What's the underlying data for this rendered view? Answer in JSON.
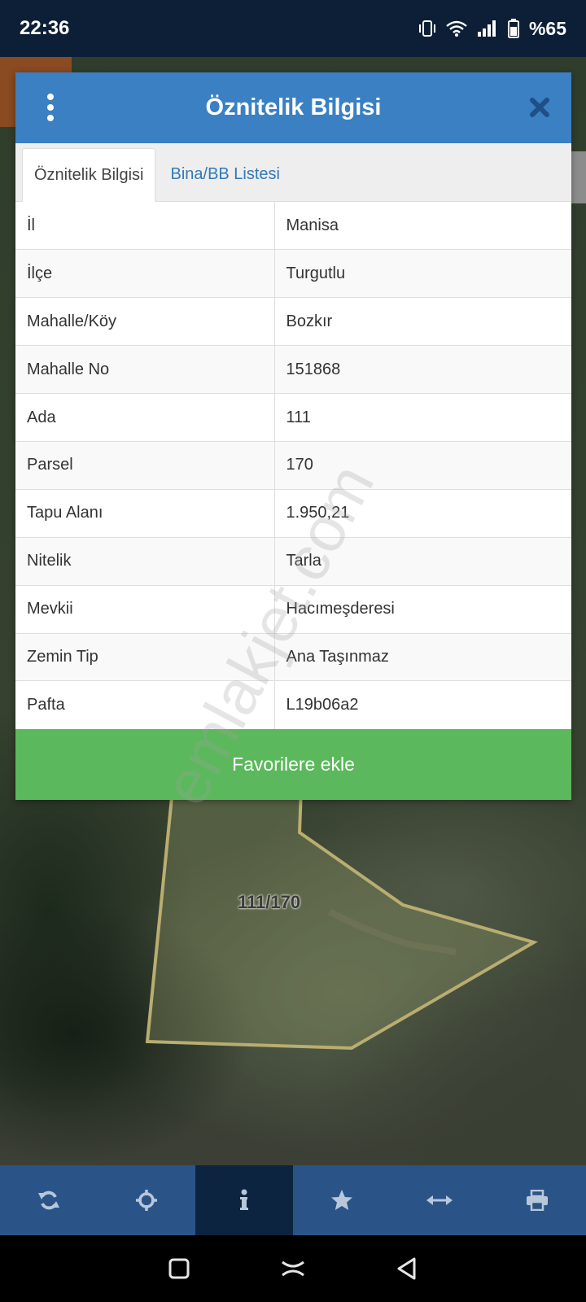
{
  "status_bar": {
    "time": "22:36",
    "battery": "%65",
    "icons": [
      "vibrate-icon",
      "wifi-icon",
      "signal-icon",
      "battery-icon"
    ]
  },
  "dialog": {
    "title": "Öznitelik Bilgisi",
    "menu_icon": "more-vertical-icon",
    "close_icon": "close-icon",
    "tabs": [
      {
        "label": "Öznitelik Bilgisi",
        "active": true
      },
      {
        "label": "Bina/BB Listesi",
        "active": false
      }
    ],
    "rows": [
      {
        "key": "İl",
        "value": "Manisa"
      },
      {
        "key": "İlçe",
        "value": "Turgutlu"
      },
      {
        "key": "Mahalle/Köy",
        "value": "Bozkır"
      },
      {
        "key": "Mahalle No",
        "value": "151868"
      },
      {
        "key": "Ada",
        "value": "111"
      },
      {
        "key": "Parsel",
        "value": "170"
      },
      {
        "key": "Tapu Alanı",
        "value": "1.950,21"
      },
      {
        "key": "Nitelik",
        "value": "Tarla"
      },
      {
        "key": "Mevkii",
        "value": "Hacımeşderesi"
      },
      {
        "key": "Zemin Tip",
        "value": "Ana Taşınmaz"
      },
      {
        "key": "Pafta",
        "value": "L19b06a2"
      }
    ],
    "favorite_button": "Favorilere ekle"
  },
  "map": {
    "parcel_label": "111/170",
    "parcel_outline_color": "#b9ad70"
  },
  "watermark": "emlakjet.com",
  "toolbar": {
    "items": [
      {
        "icon": "refresh-icon",
        "active": false
      },
      {
        "icon": "locate-icon",
        "active": false
      },
      {
        "icon": "info-icon",
        "active": true
      },
      {
        "icon": "star-icon",
        "active": false
      },
      {
        "icon": "measure-icon",
        "active": false
      },
      {
        "icon": "print-icon",
        "active": false
      }
    ]
  },
  "colors": {
    "header": "#3a80c3",
    "favorite_button": "#5cb85c",
    "toolbar": "#2a5488",
    "toolbar_active": "#0c2440",
    "status_bar": "#0d1f36"
  }
}
